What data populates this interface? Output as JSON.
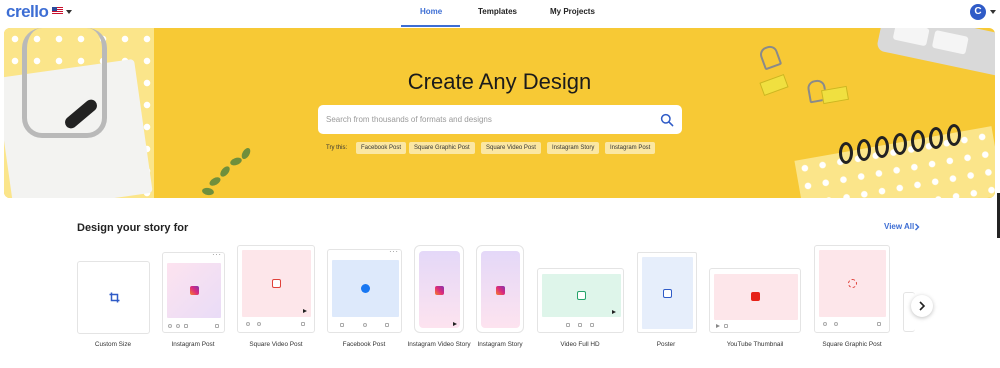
{
  "brand": {
    "logo": "crello",
    "locale_flag": "us-flag-icon"
  },
  "nav": {
    "tabs": [
      {
        "label": "Home",
        "active": true
      },
      {
        "label": "Templates"
      },
      {
        "label": "My Projects"
      }
    ]
  },
  "user": {
    "avatar_initial": "C"
  },
  "hero": {
    "title": "Create Any Design",
    "search_placeholder": "Search from thousands of formats and designs",
    "try_label": "Try this:",
    "suggestions": [
      "Facebook Post",
      "Square Graphic Post",
      "Square Video Post",
      "Instagram Story",
      "Instagram Post"
    ]
  },
  "section": {
    "title": "Design your story for",
    "view_all": "View All",
    "cards": [
      {
        "label": "Custom Size",
        "icon": "crop-icon"
      },
      {
        "label": "Instagram Post",
        "icon": "instagram-icon"
      },
      {
        "label": "Square Video Post",
        "icon": "youtube-icon"
      },
      {
        "label": "Facebook Post",
        "icon": "facebook-icon"
      },
      {
        "label": "Instagram Video Story",
        "icon": "instagram-icon"
      },
      {
        "label": "Instagram Story",
        "icon": "instagram-icon"
      },
      {
        "label": "Video Full HD",
        "icon": "play-icon"
      },
      {
        "label": "Poster",
        "icon": "poster-icon"
      },
      {
        "label": "YouTube Thumbnail",
        "icon": "youtube-icon"
      },
      {
        "label": "Square Graphic Post",
        "icon": "graphic-icon"
      }
    ]
  },
  "colors": {
    "accent": "#3d6ed4",
    "hero_bg": "#f7c935",
    "chip_bg": "#fbe7a3"
  }
}
